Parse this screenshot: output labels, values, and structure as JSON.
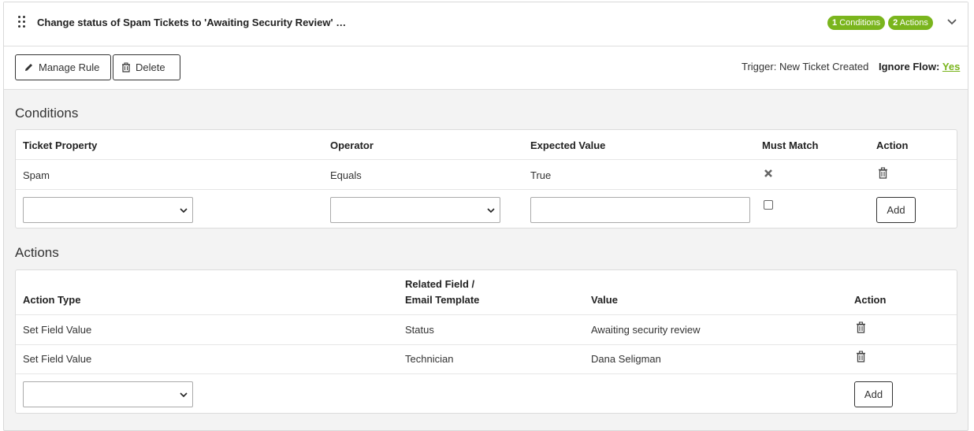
{
  "rule": {
    "title": "Change status of Spam Tickets to 'Awaiting Security Review' …",
    "badges": [
      {
        "count": "1",
        "label": "Conditions"
      },
      {
        "count": "2",
        "label": "Actions"
      }
    ]
  },
  "toolbar": {
    "manage_label": "Manage Rule",
    "delete_label": "Delete",
    "trigger_label": "Trigger:",
    "trigger_value": "New Ticket Created",
    "ignore_flow_label": "Ignore Flow:",
    "ignore_flow_value": "Yes"
  },
  "conditions": {
    "title": "Conditions",
    "headers": {
      "property": "Ticket Property",
      "operator": "Operator",
      "expected": "Expected Value",
      "must_match": "Must Match",
      "action": "Action"
    },
    "rows": [
      {
        "property": "Spam",
        "operator": "Equals",
        "expected": "True",
        "must_match": "no"
      }
    ],
    "add_label": "Add"
  },
  "actions": {
    "title": "Actions",
    "headers": {
      "type": "Action Type",
      "related_line1": "Related Field /",
      "related_line2": "Email Template",
      "value": "Value",
      "action": "Action"
    },
    "rows": [
      {
        "type": "Set Field Value",
        "related": "Status",
        "value": "Awaiting security review"
      },
      {
        "type": "Set Field Value",
        "related": "Technician",
        "value": "Dana Seligman"
      }
    ],
    "add_label": "Add"
  },
  "colors": {
    "accent": "#7ab51d",
    "background": "#f3f3f3"
  },
  "icons": [
    "drag-handle-icon",
    "chevron-down-icon",
    "pencil-icon",
    "trash-icon",
    "x-mark-icon"
  ]
}
